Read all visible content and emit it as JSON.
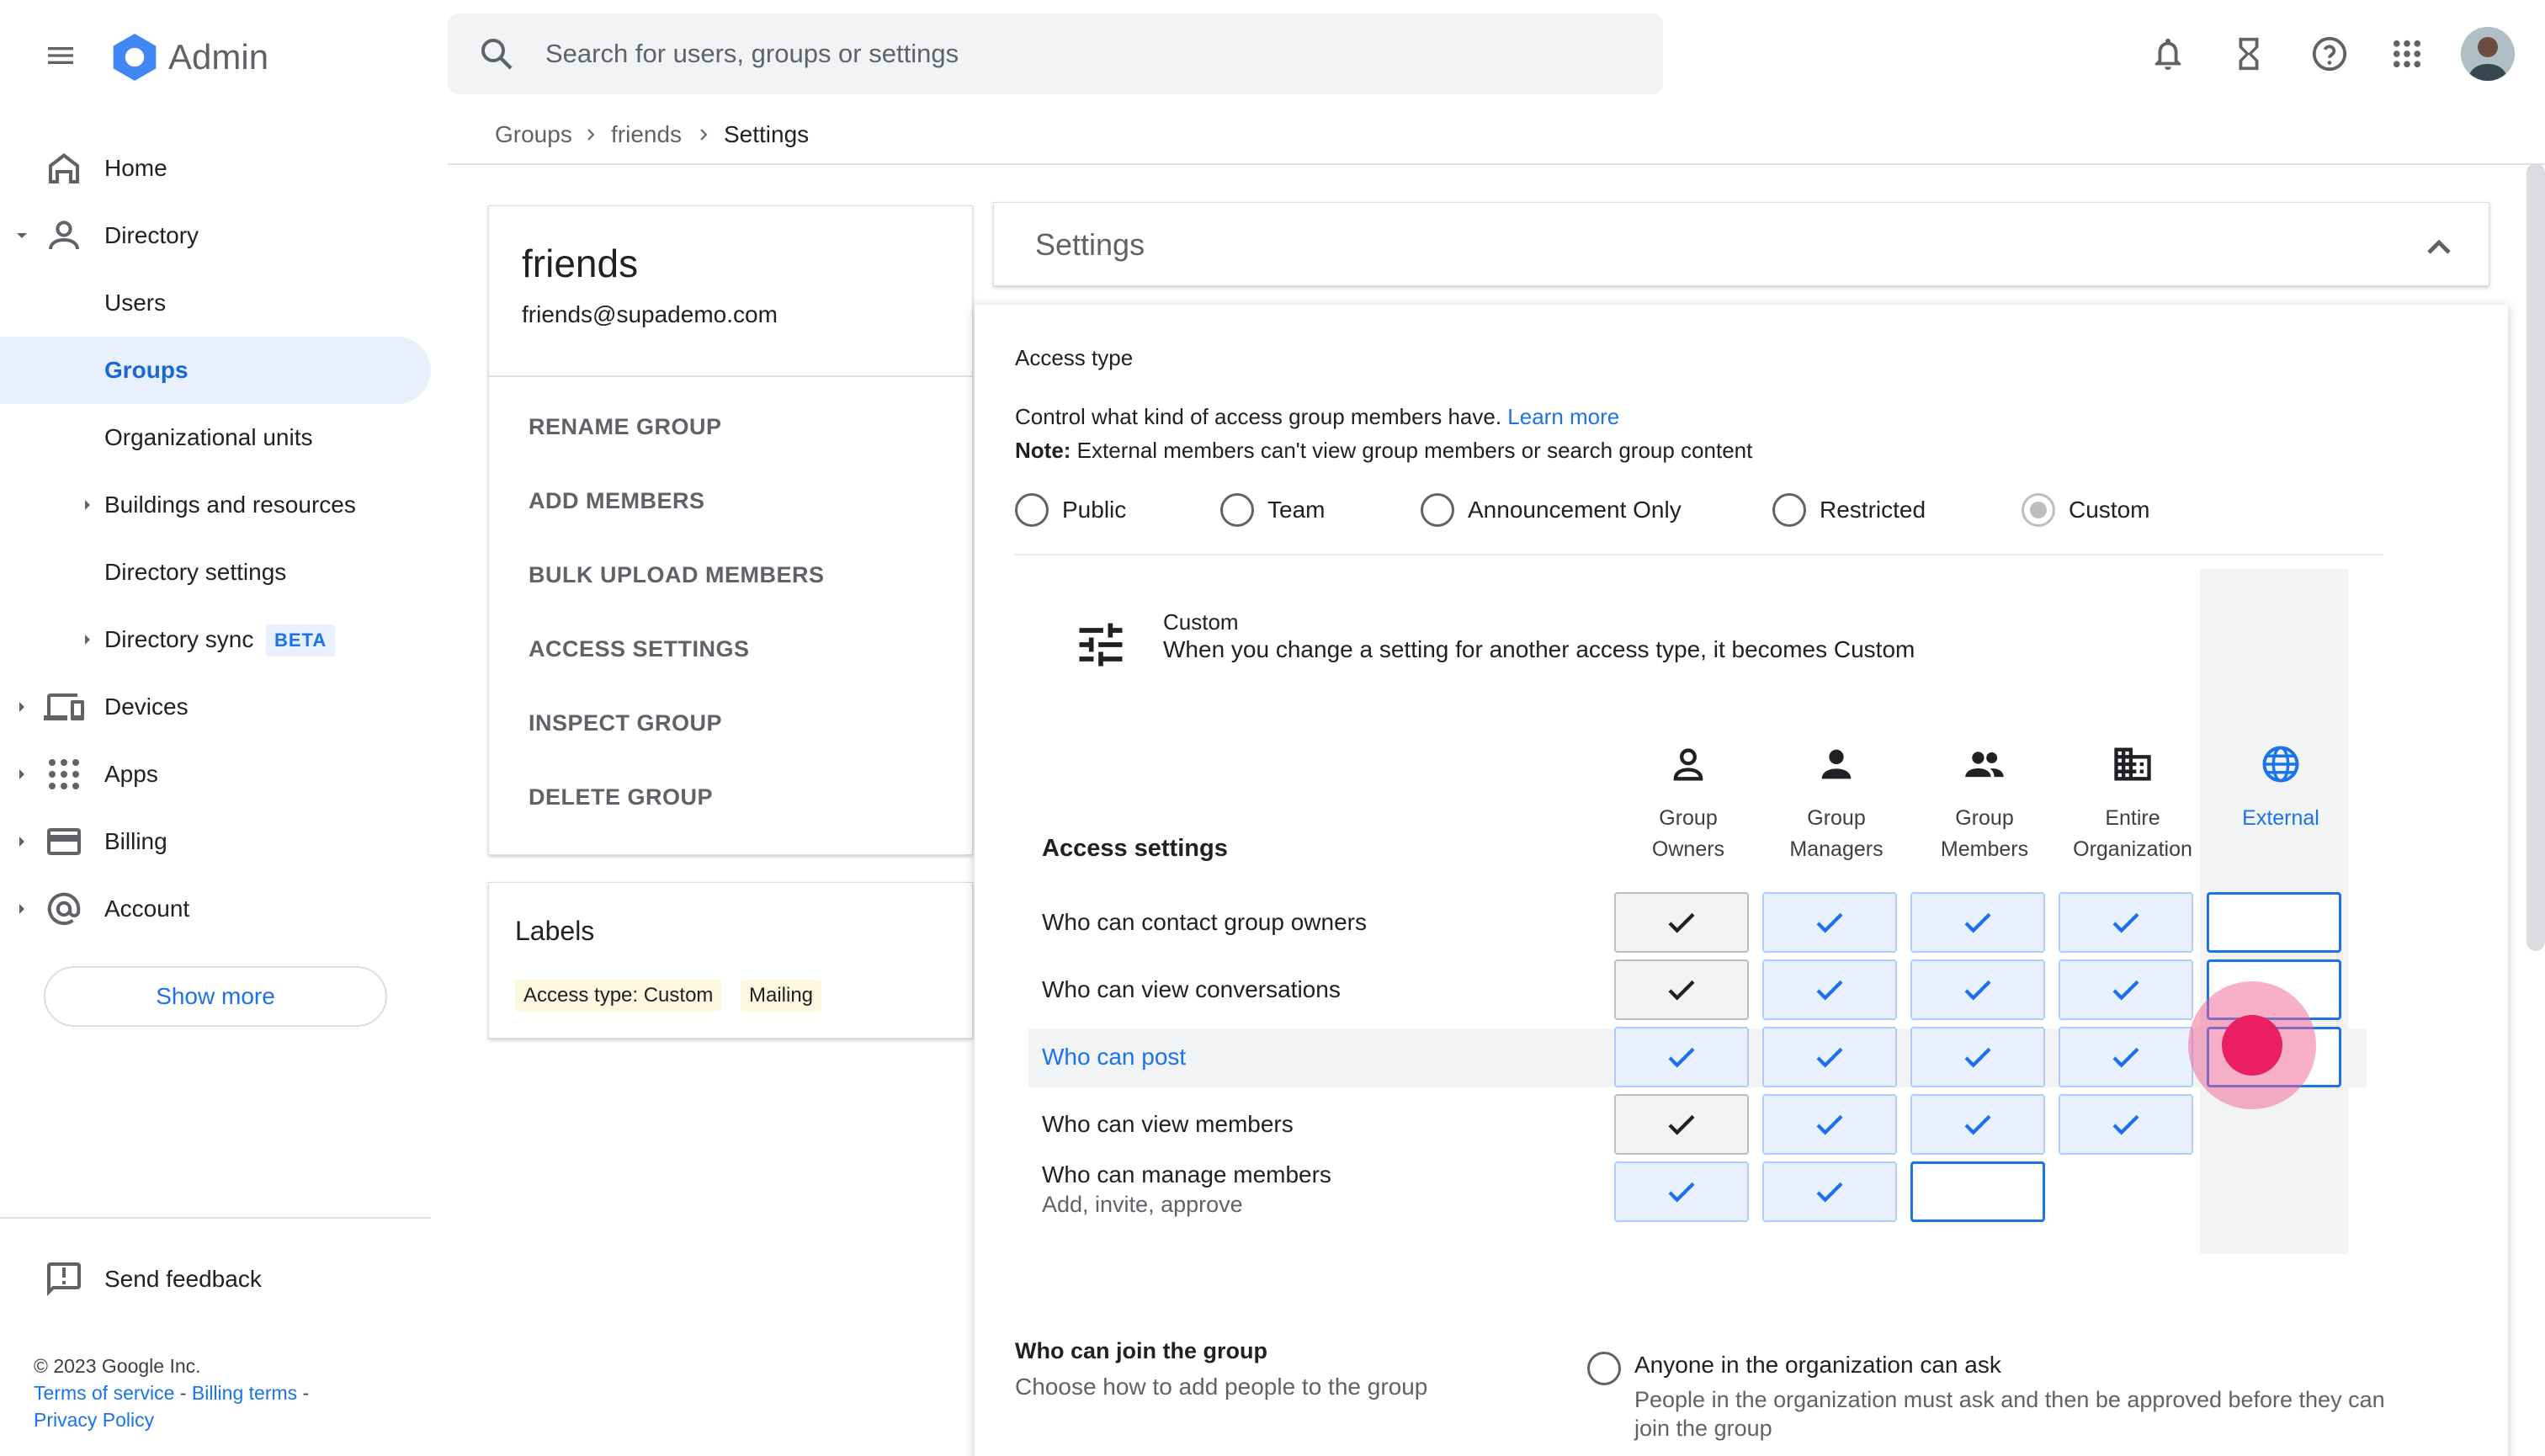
{
  "app": {
    "title": "Admin"
  },
  "search": {
    "placeholder": "Search for users, groups or settings"
  },
  "sidebar": {
    "items": [
      {
        "label": "Home"
      },
      {
        "label": "Directory"
      },
      {
        "label": "Users"
      },
      {
        "label": "Groups"
      },
      {
        "label": "Organizational units"
      },
      {
        "label": "Buildings and resources"
      },
      {
        "label": "Directory settings"
      },
      {
        "label": "Directory sync",
        "badge": "BETA"
      },
      {
        "label": "Devices"
      },
      {
        "label": "Apps"
      },
      {
        "label": "Billing"
      },
      {
        "label": "Account"
      }
    ],
    "show_more": "Show more",
    "send_feedback": "Send feedback"
  },
  "footer": {
    "copyright": "© 2023 Google Inc.",
    "terms": "Terms of service",
    "billing_terms": "Billing terms",
    "privacy": "Privacy Policy",
    "sep": " - "
  },
  "breadcrumb": [
    "Groups",
    "friends",
    "Settings"
  ],
  "group": {
    "name": "friends",
    "email": "friends@supademo.com",
    "actions": [
      "RENAME GROUP",
      "ADD MEMBERS",
      "BULK UPLOAD MEMBERS",
      "ACCESS SETTINGS",
      "INSPECT GROUP",
      "DELETE GROUP"
    ]
  },
  "labels": {
    "title": "Labels",
    "chips": [
      "Access type: Custom",
      "Mailing"
    ]
  },
  "settings": {
    "title": "Settings",
    "access_type_heading": "Access type",
    "description": "Control what kind of access group members have.",
    "learn_more": "Learn more",
    "note_label": "Note:",
    "note_text": "External members can't view group members or search group content",
    "access_types": [
      "Public",
      "Team",
      "Announcement Only",
      "Restricted",
      "Custom"
    ],
    "selected_access_type": "Custom",
    "custom_title": "Custom",
    "custom_desc": "When you change a setting for another access type, it becomes Custom",
    "access_settings_heading": "Access settings",
    "columns": [
      {
        "line1": "Group",
        "line2": "Owners",
        "icon": "person-outline-icon"
      },
      {
        "line1": "Group",
        "line2": "Managers",
        "icon": "person-icon"
      },
      {
        "line1": "Group",
        "line2": "Members",
        "icon": "people-icon"
      },
      {
        "line1": "Entire",
        "line2": "Organization",
        "icon": "domain-icon"
      },
      {
        "line1": "External",
        "line2": "",
        "icon": "globe-icon"
      }
    ],
    "rows": [
      {
        "label": "Who can contact group owners",
        "sub": ""
      },
      {
        "label": "Who can view conversations",
        "sub": ""
      },
      {
        "label": "Who can post",
        "sub": ""
      },
      {
        "label": "Who can view members",
        "sub": ""
      },
      {
        "label": "Who can manage members",
        "sub": "Add, invite, approve"
      }
    ],
    "join_heading": "Who can join the group",
    "join_sub": "Choose how to add people to the group",
    "join_option": "Anyone in the organization can ask",
    "join_option_desc": "People in the organization must ask and then be approved before they can join the group"
  },
  "colors": {
    "accent": "#1a73e8",
    "click_marker": "#e91e63"
  }
}
